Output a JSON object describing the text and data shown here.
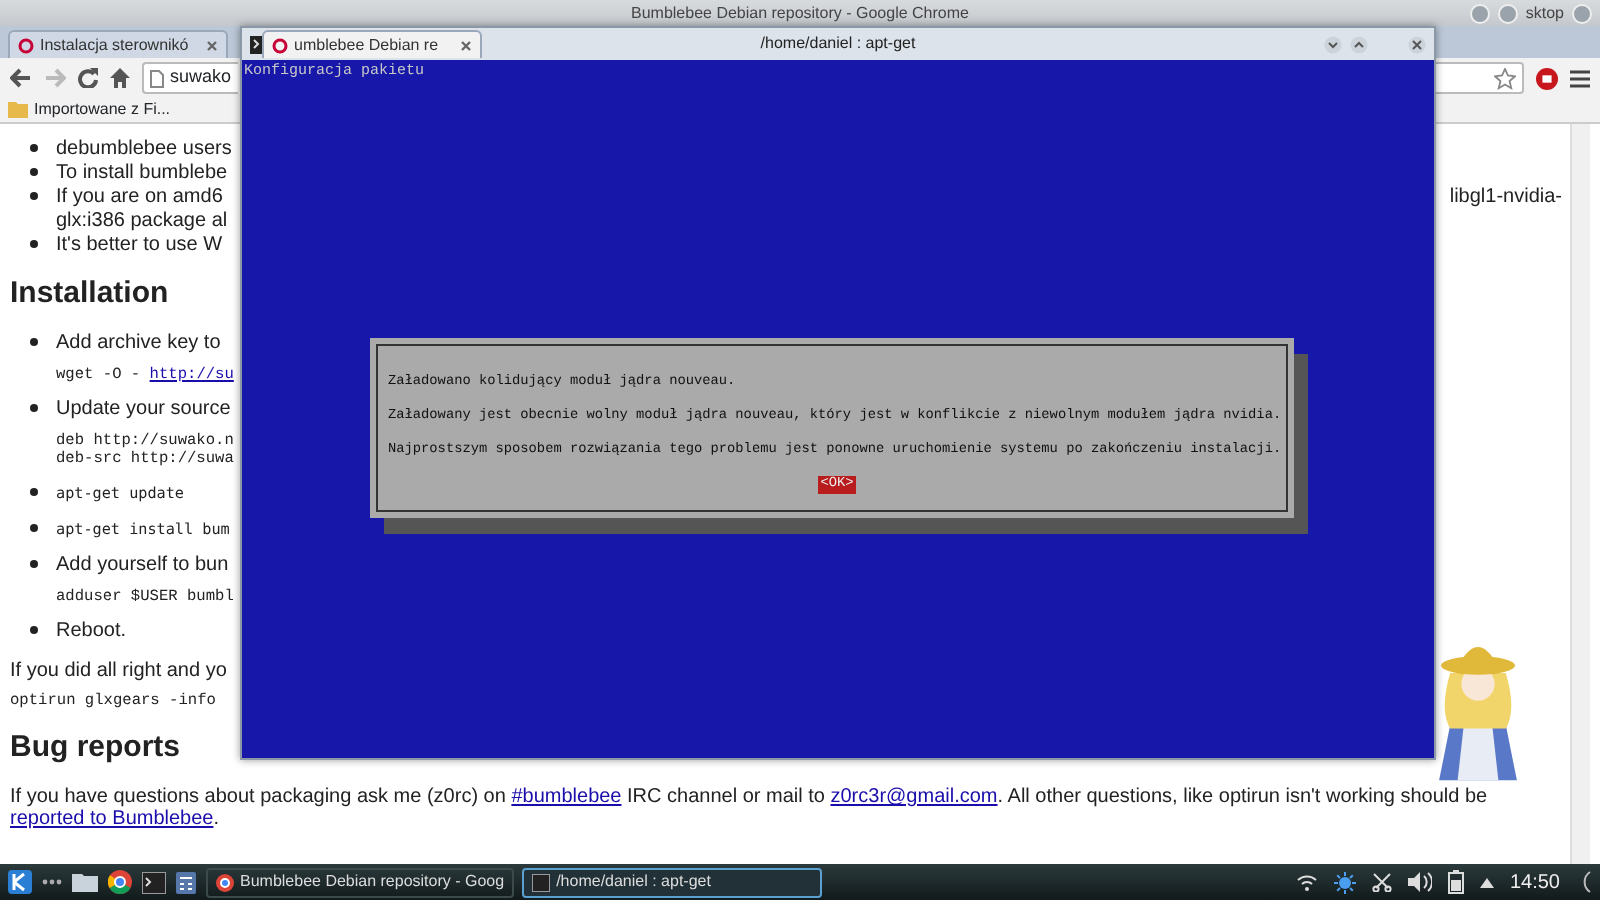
{
  "desktop": {
    "label": "sktop"
  },
  "browser": {
    "window_title": "Bumblebee Debian repository - Google Chrome",
    "tabs": [
      {
        "label": "Instalacja sterownikó",
        "selected": false
      },
      {
        "label": "umblebee Debian re",
        "selected": true
      }
    ],
    "address": "suwako",
    "bookmarks": [
      {
        "label": "Importowane z Fi..."
      }
    ],
    "content": [
      {
        "kind": "bullet",
        "lines": [
          "debumblebee users"
        ]
      },
      {
        "kind": "bullet",
        "lines": [
          "To install bumblebe"
        ]
      },
      {
        "kind": "bullet",
        "lines": [
          "If you are on amd6",
          "glx:i386 package al"
        ],
        "tail": "libgl1-nvidia-"
      },
      {
        "kind": "bullet",
        "lines": [
          "It's better to use W"
        ]
      },
      {
        "kind": "heading",
        "text": "Installation"
      },
      {
        "kind": "bullet",
        "lines": [
          "Add archive key to"
        ]
      },
      {
        "kind": "code",
        "lines": [
          [
            {
              "text": "wget -O - "
            },
            {
              "text": "http://su",
              "link": true
            }
          ]
        ]
      },
      {
        "kind": "bullet",
        "lines": [
          "Update your source"
        ]
      },
      {
        "kind": "code",
        "lines": [
          [
            {
              "text": "deb http://suwako.n"
            }
          ],
          [
            {
              "text": "deb-src http://suwa"
            }
          ]
        ]
      },
      {
        "kind": "bullet_code",
        "text": "apt-get update"
      },
      {
        "kind": "bullet_code",
        "text": "apt-get install bum"
      },
      {
        "kind": "bullet",
        "lines": [
          "Add yourself to bun"
        ]
      },
      {
        "kind": "code",
        "lines": [
          [
            {
              "text": "adduser $USER bumbl"
            }
          ]
        ]
      },
      {
        "kind": "bullet",
        "lines": [
          "Reboot."
        ]
      },
      {
        "kind": "paragraph",
        "segments": [
          {
            "text": "If you did all right and yo"
          }
        ]
      },
      {
        "kind": "code_plain",
        "lines": [
          [
            {
              "text": "optirun glxgears -info"
            }
          ]
        ]
      },
      {
        "kind": "heading",
        "text": "Bug reports"
      },
      {
        "kind": "paragraph",
        "segments": [
          {
            "text": "If you have questions about packaging ask me (z0rc) on "
          },
          {
            "text": "#bumblebee",
            "link": true
          },
          {
            "text": " IRC channel or mail to "
          },
          {
            "text": "z0rc3r@gmail.com",
            "link": true
          },
          {
            "text": ". All other questions, like optirun isn't working should be "
          },
          {
            "text": "reported to Bumblebee",
            "link": true
          },
          {
            "text": "."
          }
        ]
      }
    ]
  },
  "terminal": {
    "title": "/home/daniel : apt-get",
    "header": "Konfiguracja pakietu",
    "dialog": {
      "lines": [
        "Załadowano kolidujący moduł jądra nouveau.",
        "Załadowany jest obecnie wolny moduł jądra nouveau, który jest w konflikcie z niewolnym modułem jądra nvidia.",
        "Najprostszym sposobem rozwiązania tego problemu jest ponowne uruchomienie systemu po zakończeniu instalacji."
      ],
      "button": "<OK>"
    }
  },
  "taskbar": {
    "tasks": [
      {
        "label": "Bumblebee Debian repository - Goog",
        "kind": "browser",
        "selected": false
      },
      {
        "label": "/home/daniel : apt-get",
        "kind": "terminal",
        "selected": true
      }
    ],
    "clock": "14:50"
  }
}
